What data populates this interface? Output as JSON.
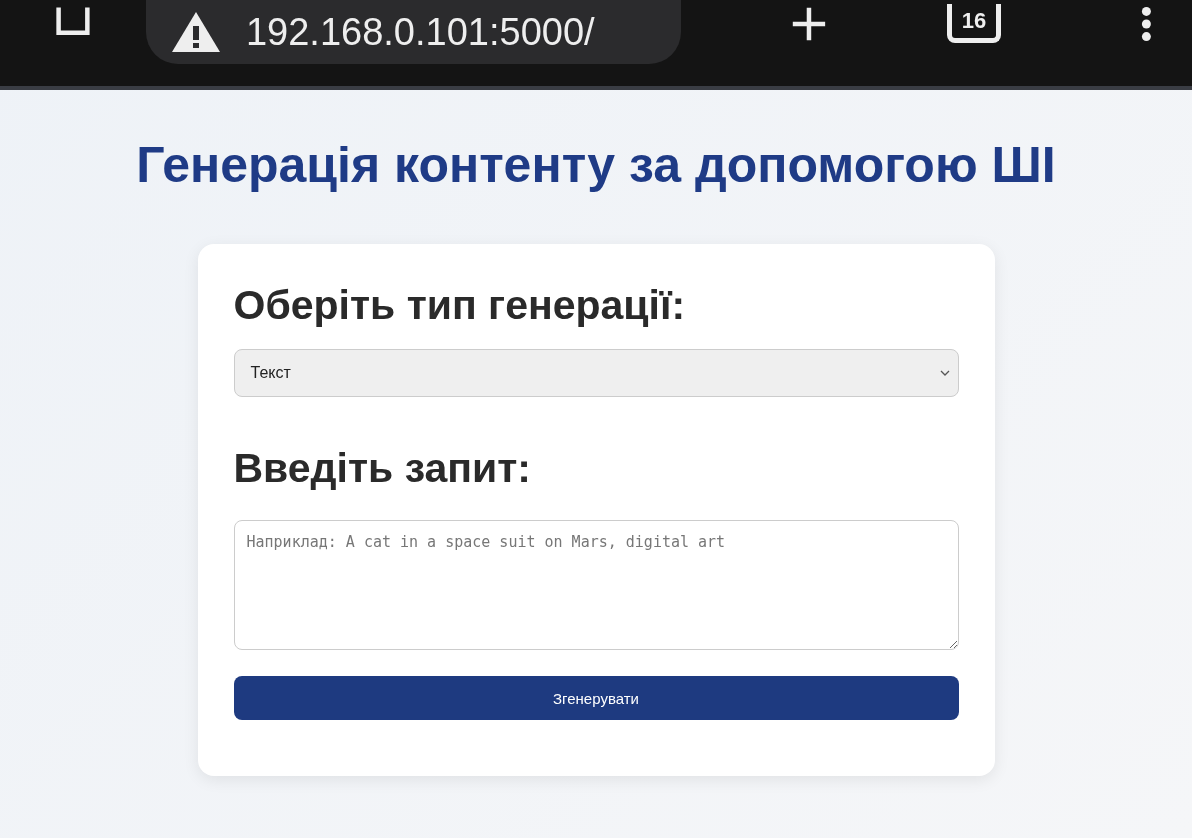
{
  "browser_bar": {
    "url": "192.168.0.101:5000/",
    "tab_count": "16"
  },
  "title": "Генерація контенту за допомогою ШІ",
  "form": {
    "type_label": "Оберіть тип генерації:",
    "type_select": {
      "value": "Текст"
    },
    "prompt_label": "Введіть запит:",
    "prompt_field": {
      "placeholder": "Наприклад: A cat in a space suit on Mars, digital art"
    },
    "submit_button": "Згенерувати"
  }
}
